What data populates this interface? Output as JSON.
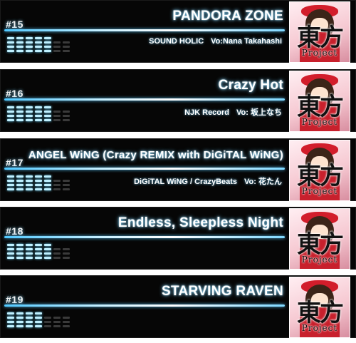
{
  "songs": [
    {
      "number": "#15",
      "title": "PANDORA ZONE",
      "meta_left": "SOUND HOLIC",
      "meta_right": "Vo:Nana Takahashi",
      "level": 5,
      "jacket": {
        "kanji": "東方",
        "sub": "Project"
      }
    },
    {
      "number": "#16",
      "title": "Crazy Hot",
      "meta_left": "NJK Record",
      "meta_right": "Vo: 坂上なち",
      "level": 5,
      "jacket": {
        "kanji": "東方",
        "sub": "Project"
      }
    },
    {
      "number": "#17",
      "title": "ANGEL WiNG (Crazy REMIX with DiGiTAL WiNG)",
      "meta_left": "DiGiTAL WiNG / CrazyBeats",
      "meta_right": "Vo: 花たん",
      "level": 5,
      "jacket": {
        "kanji": "東方",
        "sub": "Project"
      }
    },
    {
      "number": "#18",
      "title": "Endless, Sleepless Night",
      "meta_left": "",
      "meta_right": "",
      "level": 5,
      "jacket": {
        "kanji": "東方",
        "sub": "Project"
      }
    },
    {
      "number": "#19",
      "title": "STARVING RAVEN",
      "meta_left": "",
      "meta_right": "",
      "level": 4,
      "jacket": {
        "kanji": "東方",
        "sub": "Project"
      }
    }
  ],
  "level_max": 7,
  "colors": {
    "card_bg": "#060606",
    "glow": "#4fc8ff",
    "bar_on": "#bff0ff",
    "bar_off": "#3a3a3a"
  }
}
